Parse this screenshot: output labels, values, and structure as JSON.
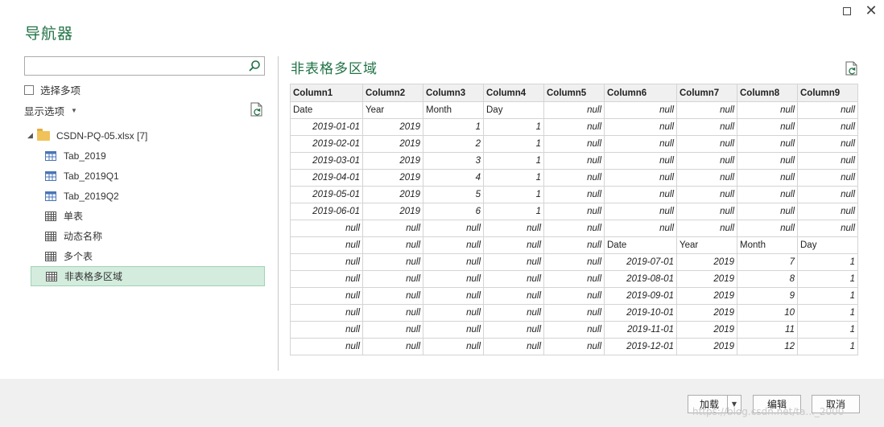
{
  "window": {
    "title": "导航器"
  },
  "left": {
    "search": {
      "placeholder": "",
      "value": ""
    },
    "multi_select_label": "选择多项",
    "display_options_label": "显示选项",
    "tree": {
      "root": "CSDN-PQ-05.xlsx [7]",
      "items": [
        {
          "label": "Tab_2019",
          "icon": "table-icon"
        },
        {
          "label": "Tab_2019Q1",
          "icon": "table-icon"
        },
        {
          "label": "Tab_2019Q2",
          "icon": "table-icon"
        },
        {
          "label": "单表",
          "icon": "sheet-icon"
        },
        {
          "label": "动态名称",
          "icon": "sheet-icon"
        },
        {
          "label": "多个表",
          "icon": "sheet-icon"
        },
        {
          "label": "非表格多区域",
          "icon": "sheet-icon",
          "selected": true
        }
      ]
    }
  },
  "preview": {
    "title": "非表格多区域",
    "columns": [
      "Column1",
      "Column2",
      "Column3",
      "Column4",
      "Column5",
      "Column6",
      "Column7",
      "Column8",
      "Column9"
    ],
    "rows": [
      [
        "Date",
        "Year",
        "Month",
        "Day",
        "null",
        "null",
        "null",
        "null",
        "null"
      ],
      [
        "2019-01-01",
        "2019",
        "1",
        "1",
        "null",
        "null",
        "null",
        "null",
        "null"
      ],
      [
        "2019-02-01",
        "2019",
        "2",
        "1",
        "null",
        "null",
        "null",
        "null",
        "null"
      ],
      [
        "2019-03-01",
        "2019",
        "3",
        "1",
        "null",
        "null",
        "null",
        "null",
        "null"
      ],
      [
        "2019-04-01",
        "2019",
        "4",
        "1",
        "null",
        "null",
        "null",
        "null",
        "null"
      ],
      [
        "2019-05-01",
        "2019",
        "5",
        "1",
        "null",
        "null",
        "null",
        "null",
        "null"
      ],
      [
        "2019-06-01",
        "2019",
        "6",
        "1",
        "null",
        "null",
        "null",
        "null",
        "null"
      ],
      [
        "null",
        "null",
        "null",
        "null",
        "null",
        "null",
        "null",
        "null",
        "null"
      ],
      [
        "null",
        "null",
        "null",
        "null",
        "null",
        "Date",
        "Year",
        "Month",
        "Day"
      ],
      [
        "null",
        "null",
        "null",
        "null",
        "null",
        "2019-07-01",
        "2019",
        "7",
        "1"
      ],
      [
        "null",
        "null",
        "null",
        "null",
        "null",
        "2019-08-01",
        "2019",
        "8",
        "1"
      ],
      [
        "null",
        "null",
        "null",
        "null",
        "null",
        "2019-09-01",
        "2019",
        "9",
        "1"
      ],
      [
        "null",
        "null",
        "null",
        "null",
        "null",
        "2019-10-01",
        "2019",
        "10",
        "1"
      ],
      [
        "null",
        "null",
        "null",
        "null",
        "null",
        "2019-11-01",
        "2019",
        "11",
        "1"
      ],
      [
        "null",
        "null",
        "null",
        "null",
        "null",
        "2019-12-01",
        "2019",
        "12",
        "1"
      ]
    ]
  },
  "footer": {
    "load_label": "加载",
    "edit_label": "编辑",
    "cancel_label": "取消"
  },
  "watermark": "https://blog.csdn.net/ta..._2000",
  "colors": {
    "accent": "#217346",
    "selection": "#d3ecdd",
    "folder": "#f0c25a"
  }
}
